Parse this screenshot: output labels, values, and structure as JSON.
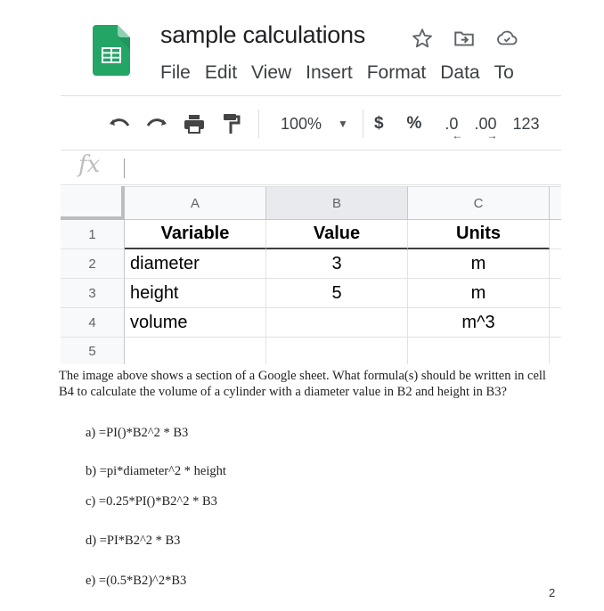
{
  "app": {
    "title": "sample calculations",
    "title_icons": [
      "star-icon",
      "move-to-folder-icon",
      "cloud-saved-icon"
    ],
    "menu": [
      "File",
      "Edit",
      "View",
      "Insert",
      "Format",
      "Data",
      "To"
    ]
  },
  "toolbar": {
    "icons": [
      "undo-icon",
      "redo-icon",
      "print-icon",
      "paint-format-icon"
    ],
    "zoom": "100%",
    "currency": "$",
    "percent": "%",
    "decrease_decimal": ".0",
    "increase_decimal": ".00",
    "more_formats": "123"
  },
  "formula_bar": {
    "label": "fx",
    "value": ""
  },
  "sheet": {
    "columns": [
      "A",
      "B",
      "C"
    ],
    "selected_column": "B",
    "row_numbers": [
      "1",
      "2",
      "3",
      "4",
      "5"
    ],
    "rows": [
      [
        "Variable",
        "Value",
        "Units"
      ],
      [
        "diameter",
        "3",
        "m"
      ],
      [
        "height",
        "5",
        "m"
      ],
      [
        "volume",
        "",
        "m^3"
      ],
      [
        "",
        "",
        ""
      ]
    ]
  },
  "question": {
    "text": "The image above shows a section of a Google sheet. What formula(s) should be written in cell B4 to calculate the volume of a cylinder with a diameter value in B2 and height in B3?",
    "options": [
      "a) =PI()*B2^2 * B3",
      "b) =pi*diameter^2 * height",
      "c) =0.25*PI()*B2^2 * B3",
      "d) =PI*B2^2 * B3",
      "e) =(0.5*B2)^2*B3"
    ]
  },
  "page_number": "2",
  "colors": {
    "sheets_green": "#23a566",
    "sheets_green_dark": "#188038",
    "header_bg": "#f8f9fa",
    "selected_header_bg": "#e8eaed"
  }
}
